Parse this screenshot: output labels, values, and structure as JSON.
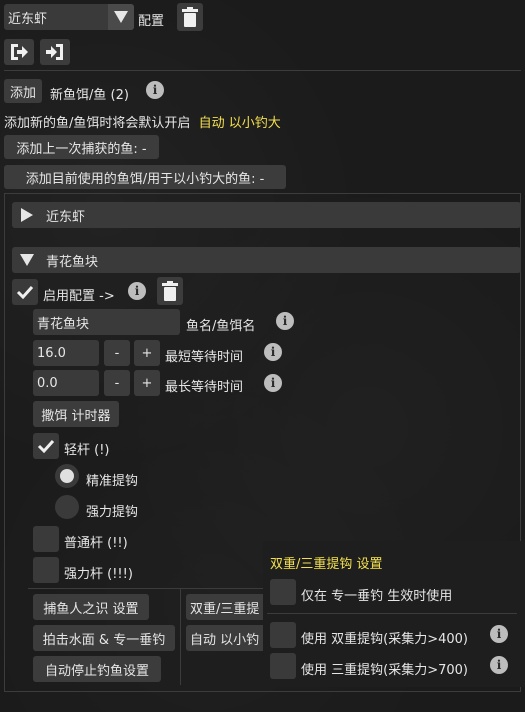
{
  "top": {
    "fish_select": "近东虾",
    "config_label": "配置"
  },
  "add_section": {
    "add_button": "添加",
    "new_bait_label": "新鱼饵/鱼 (2)",
    "auto_enable_text": "添加新的鱼/鱼饵时将会默认开启",
    "auto_enable_highlight": "自动 以小钓大",
    "add_last_caught": "添加上一次捕获的鱼: -",
    "add_current_bait": "添加目前使用的鱼饵/用于以小钓大的鱼: -"
  },
  "entries": [
    {
      "name": "近东虾",
      "expanded": false
    },
    {
      "name": "青花鱼块",
      "expanded": true
    }
  ],
  "entry_detail": {
    "enable_config": "启用配置 ->",
    "fish_name_value": "青花鱼块",
    "fish_name_label": "鱼名/鱼饵名",
    "min_wait_value": "16.0",
    "min_wait_label": "最短等待时间",
    "max_wait_value": "0.0",
    "max_wait_label": "最长等待时间",
    "minus": "-",
    "plus": "+",
    "bait_timer": "撒饵 计时器",
    "light_rod": "轻杆 (!)",
    "precision_hook": "精准提钩",
    "power_hook": "强力提钩",
    "normal_rod": "普通杆 (!!)",
    "heavy_rod": "强力杆 (!!!)",
    "fisher_intuition": "捕鱼人之识 设置",
    "double_triple_btn": "双重/三重提",
    "surface_slap": "拍击水面 & 专一垂钓",
    "auto_mooch_btn": "自动 以小钓",
    "auto_stop": "自动停止钓鱼设置"
  },
  "popup": {
    "title": "双重/三重提钩 设置",
    "only_identical": "仅在 专一垂钓 生效时使用",
    "use_double": "使用 双重提钩(采集力>400)",
    "use_triple": "使用 三重提钩(采集力>700)"
  },
  "colors": {
    "accent_yellow": "#f4e04d",
    "button_bg": "#3c3c3c"
  }
}
